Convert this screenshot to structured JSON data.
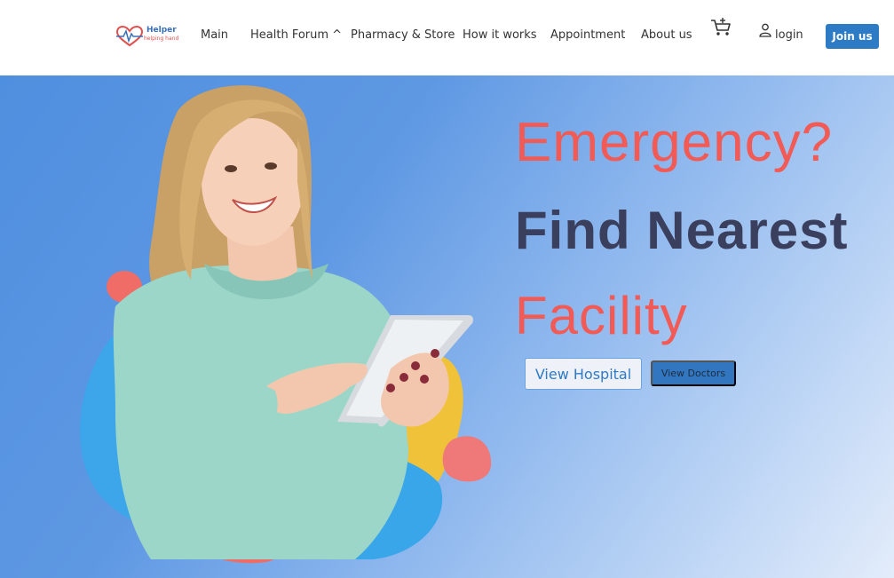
{
  "header": {
    "logo_title": "Helper",
    "logo_tagline": "helping hand",
    "nav": {
      "main": "Main",
      "forum": "Health Forum ^",
      "pharmacy": "Pharmacy & Store",
      "how": "How it works",
      "appointment": "Appointment",
      "about": "About us"
    },
    "cart_icon": "cart-icon",
    "user_icon": "user-icon",
    "login": "login",
    "join": "Join us"
  },
  "hero": {
    "line1": "Emergency?",
    "line2": "Find Nearest",
    "line3": "Facility",
    "view_hospital": "View Hospital",
    "view_doctors": "View Doctors"
  },
  "colors": {
    "accent_red": "#f25a55",
    "dark_text": "#3b3f5e",
    "primary_blue": "#2c7bc4",
    "hero_blue": "#4f8fdf"
  }
}
